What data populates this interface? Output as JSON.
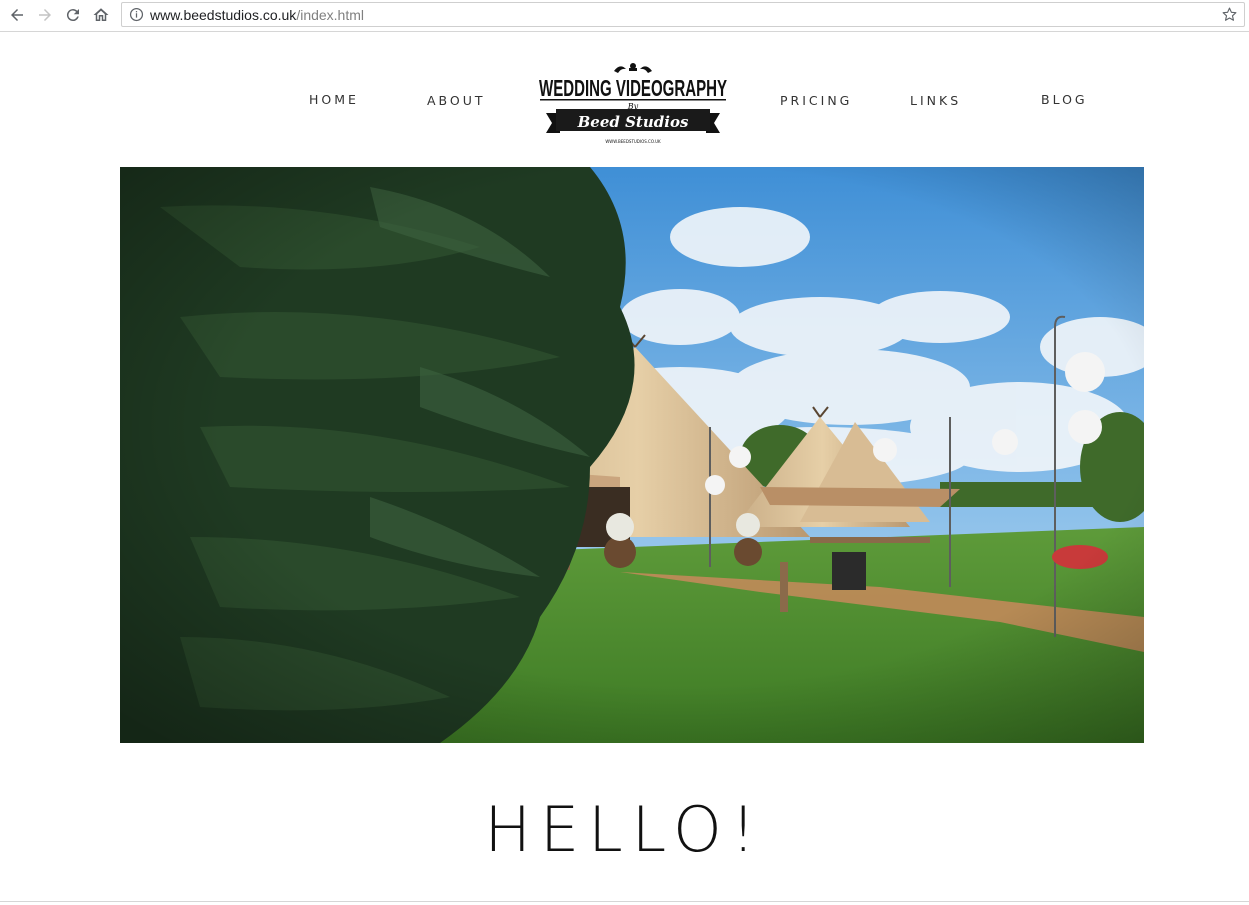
{
  "browser": {
    "url_host": "www.beedstudios.co.uk",
    "url_path": "/index.html",
    "back_icon": "arrow-left-icon",
    "forward_icon": "arrow-right-icon",
    "reload_icon": "reload-icon",
    "home_icon": "home-icon",
    "info_icon": "info-icon",
    "bookmark_icon": "star-icon"
  },
  "nav": {
    "home": "HOME",
    "about": "ABOUT",
    "pricing": "PRICING",
    "links": "LINKS",
    "blog": "BLOG"
  },
  "logo": {
    "line1": "WEDDING VIDEOGRAPHY",
    "by": "By",
    "line2": "Beed Studios",
    "small": "WWW.BEEDSTUDIOS.CO.UK"
  },
  "hero": {
    "alt_icon": "hero-photo"
  },
  "main": {
    "heading": "HELLO!"
  }
}
